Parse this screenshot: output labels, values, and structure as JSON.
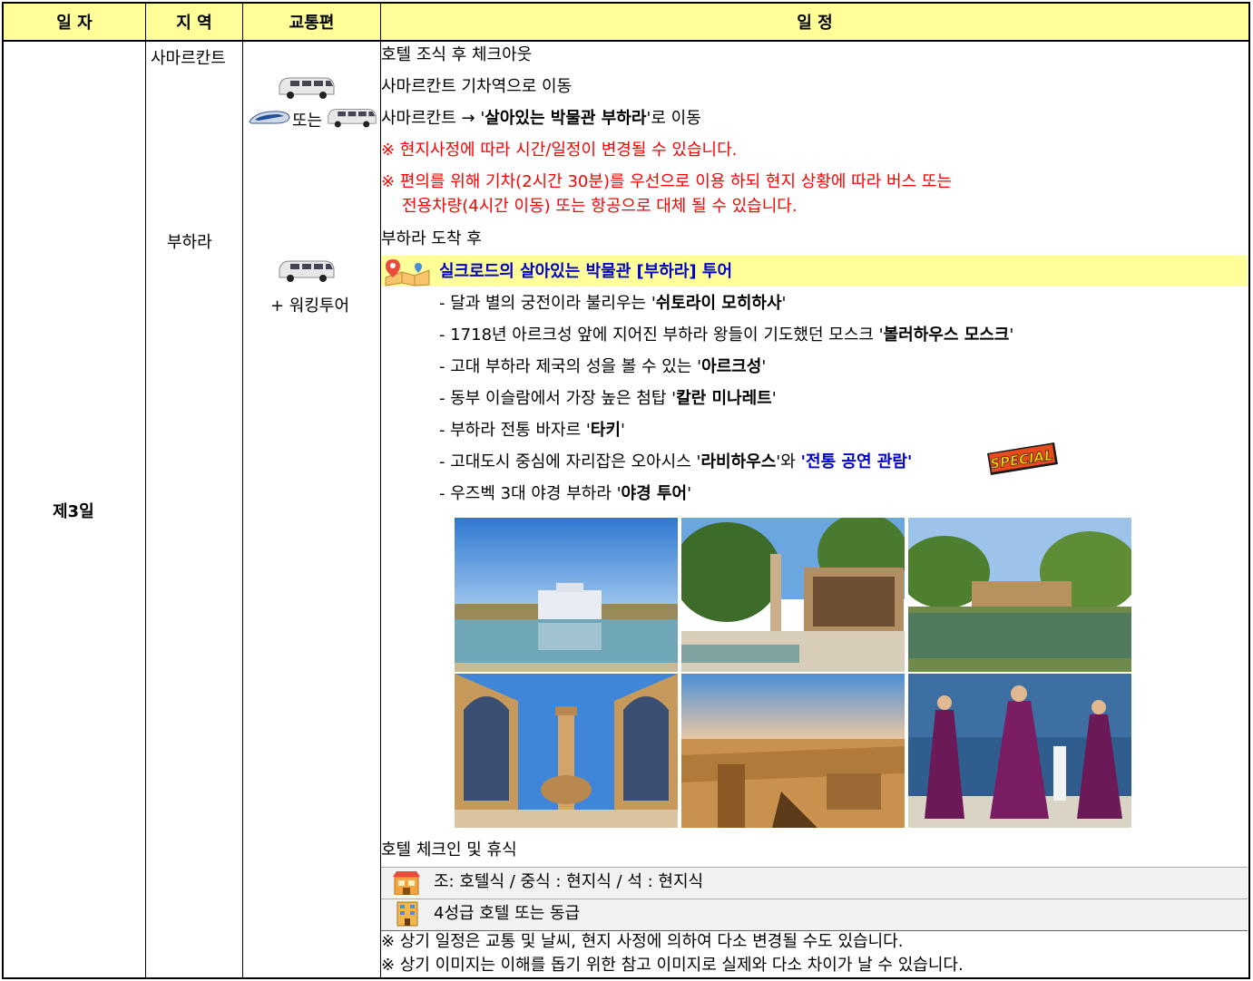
{
  "header": {
    "date": "일 자",
    "region": "지 역",
    "transport": "교통편",
    "schedule": "일 정"
  },
  "day": "제3일",
  "regions": [
    "사마르칸트",
    "부하라"
  ],
  "transport": {
    "or_text": "또는",
    "walking_tour": "+ 워킹투어"
  },
  "schedule": {
    "l1": "호텔 조식 후 체크아웃",
    "l2": "사마르칸트 기차역으로 이동",
    "l3_pre": "사마르칸트 → '",
    "l3_bold": "살아있는 박물관 부하라",
    "l3_post": "'로 이동",
    "notice1": "※ 현지사정에 따라 시간/일정이 변경될 수 있습니다.",
    "notice2a": "※ 편의를 위해 기차(2시간 30분)를 우선으로 이용 하되 현지 상황에 따라 버스 또는",
    "notice2b": "전용차량(4시간 이동) 또는 항공으로 대체 될 수 있습니다.",
    "arrive": "부하라 도착 후",
    "tour_title": "실크로드의 살아있는 박물관 [부하라] 투어",
    "items": [
      {
        "pre": "- 달과 별의 궁전이라 불리우는 '",
        "bold": "쉬토라이 모히하사",
        "post": "'"
      },
      {
        "pre": "- 1718년 아르크성 앞에 지어진 부하라 왕들이 기도했던 모스크 '",
        "bold": "볼러하우스 모스크",
        "post": "'"
      },
      {
        "pre": "- 고대 부하라 제국의 성을 볼 수 있는 '",
        "bold": "아르크성",
        "post": "'"
      },
      {
        "pre": "- 동부 이슬람에서 가장 높은 첨탑 '",
        "bold": "칼란 미나레트",
        "post": "'"
      },
      {
        "pre": "- 부하라 전통 바자르 '",
        "bold": "타키",
        "post": "'"
      }
    ],
    "item6_pre": "- 고대도시 중심에 자리잡은 오아시스 '",
    "item6_bold": "라비하우스",
    "item6_mid": "'와 ",
    "item6_blue": "'전통 공연 관람'",
    "special_badge": "SPECIAL",
    "item7_pre": "- 우즈벡 3대 야경 부하라 '",
    "item7_bold": "야경 투어",
    "item7_post": "'",
    "checkin": "호텔 체크인 및 휴식",
    "meals": "조: 호텔식 / 중식 : 현지식 / 석 : 현지식",
    "hotel": "4성급 호텔 또는 동급",
    "footer1": "※ 상기 일정은 교통 및 날씨, 현지 사정에 의하여 다소 변경될 수도 있습니다.",
    "footer2": "※ 상기 이미지는 이해를 돕기 위한 참고 이미지로 실제와 다소 차이가 날 수 있습니다."
  },
  "icons": [
    "van-icon",
    "train-icon",
    "map-pin-icon",
    "restaurant-icon",
    "hotel-icon",
    "special-badge-icon"
  ],
  "colors": {
    "header_bg": "#ffff99",
    "highlight_bg": "#ffff99",
    "notice": "#ff0000",
    "accent": "#0000cc",
    "grey_bg": "#f2f2f2"
  }
}
